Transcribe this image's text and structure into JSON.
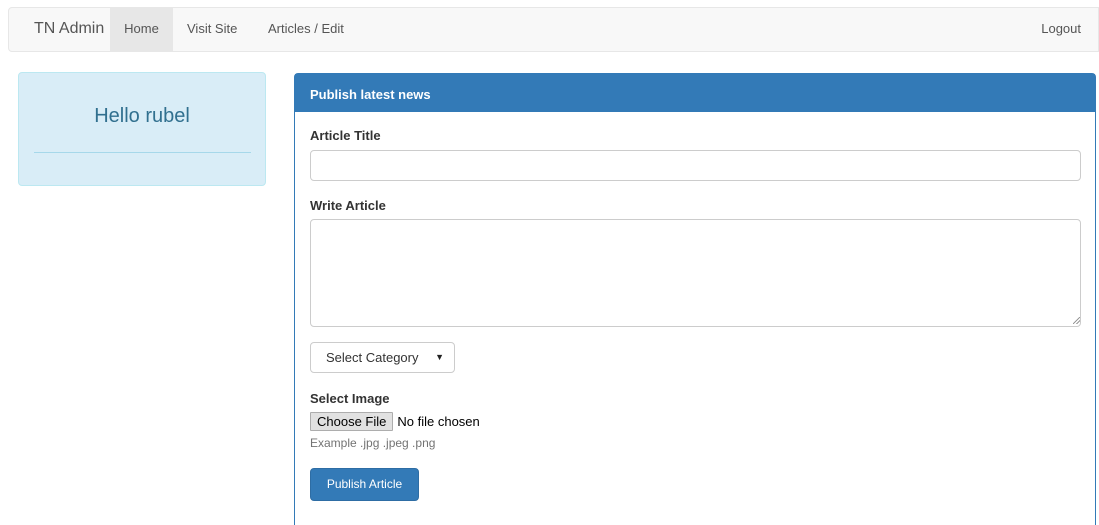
{
  "navbar": {
    "brand": "TN Admin",
    "items": [
      {
        "label": "Home",
        "active": true
      },
      {
        "label": "Visit Site",
        "active": false
      },
      {
        "label": "Articles / Edit",
        "active": false
      }
    ],
    "logout": "Logout"
  },
  "greeting": {
    "text": "Hello rubel"
  },
  "panel": {
    "heading": "Publish latest news",
    "title_label": "Article Title",
    "title_value": "",
    "article_label": "Write Article",
    "article_value": "",
    "category": {
      "selected": "Select Category",
      "arrow": "▼"
    },
    "image_label": "Select Image",
    "file_button": "Choose File",
    "file_status": "No file chosen",
    "image_help": "Example .jpg .jpeg .png",
    "submit_label": "Publish Article"
  },
  "colors": {
    "primary": "#337ab7",
    "info_bg": "#d9edf7",
    "info_text": "#31708f",
    "navbar_bg": "#f8f8f8"
  }
}
